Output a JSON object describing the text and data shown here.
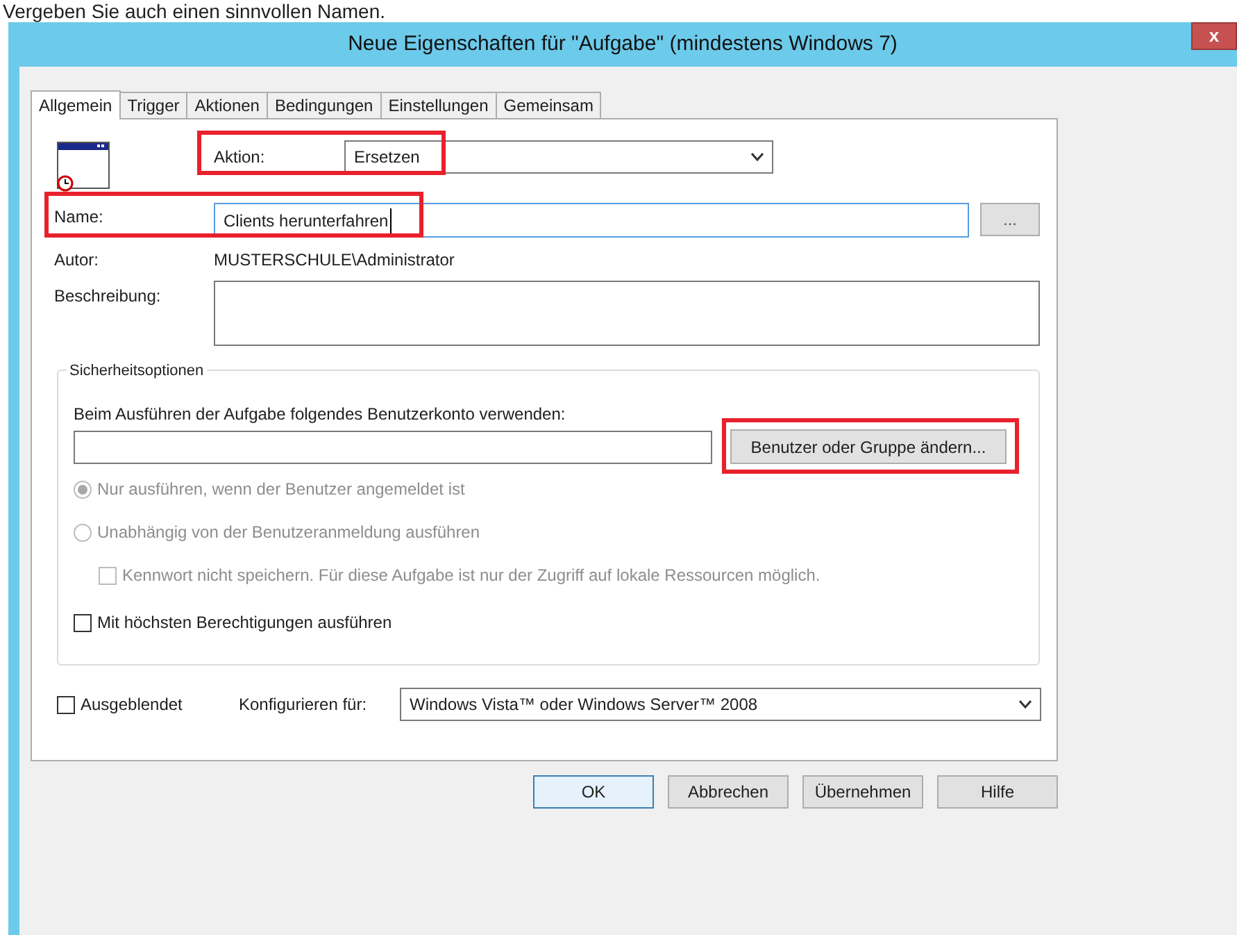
{
  "caption": "Vergeben Sie auch einen sinnvollen Namen.",
  "window": {
    "title": "Neue Eigenschaften für \"Aufgabe\" (mindestens Windows 7)",
    "close": "x"
  },
  "tabs": [
    {
      "label": "Allgemein",
      "selected": true
    },
    {
      "label": "Trigger",
      "selected": false
    },
    {
      "label": "Aktionen",
      "selected": false
    },
    {
      "label": "Bedingungen",
      "selected": false
    },
    {
      "label": "Einstellungen",
      "selected": false
    },
    {
      "label": "Gemeinsam",
      "selected": false
    }
  ],
  "action": {
    "label": "Aktion:",
    "value": "Ersetzen",
    "highlighted": true
  },
  "name": {
    "label": "Name:",
    "value": "Clients herunterfahren",
    "highlighted": true,
    "browse": "..."
  },
  "author": {
    "label": "Autor:",
    "value": "MUSTERSCHULE\\Administrator"
  },
  "description": {
    "label": "Beschreibung:"
  },
  "security": {
    "legend": "Sicherheitsoptionen",
    "account_label": "Beim Ausführen der Aufgabe folgendes Benutzerkonto verwenden:",
    "change_button": {
      "label": "Benutzer oder Gruppe ändern...",
      "highlighted": true
    },
    "options": [
      {
        "kind": "radio",
        "label": "Nur ausführen, wenn der Benutzer angemeldet ist",
        "selected": true,
        "disabled": true
      },
      {
        "kind": "radio",
        "label": "Unabhängig von der Benutzeranmeldung ausführen",
        "selected": false,
        "disabled": true
      },
      {
        "kind": "checkbox",
        "label": "Kennwort nicht speichern. Für diese Aufgabe ist nur der Zugriff auf lokale Ressourcen möglich.",
        "checked": false,
        "disabled": true
      },
      {
        "kind": "checkbox",
        "label": "Mit höchsten Berechtigungen ausführen",
        "checked": false,
        "disabled": false
      }
    ]
  },
  "hidden": {
    "label": "Ausgeblendet",
    "checked": false
  },
  "configure": {
    "label": "Konfigurieren für:",
    "value": "Windows Vista™ oder Windows Server™ 2008"
  },
  "buttons": [
    {
      "label": "OK",
      "default": true
    },
    {
      "label": "Abbrechen",
      "default": false
    },
    {
      "label": "Übernehmen",
      "default": false
    },
    {
      "label": "Hilfe",
      "default": false
    }
  ]
}
